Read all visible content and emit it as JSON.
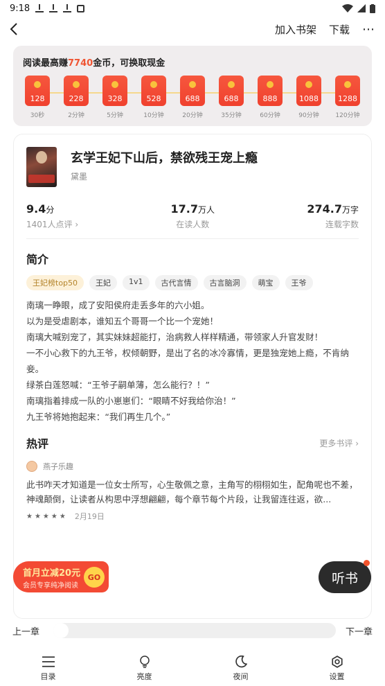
{
  "status_bar": {
    "time": "9:18"
  },
  "top_bar": {
    "add_shelf": "加入书架",
    "download": "下载",
    "more": "⋯"
  },
  "reward": {
    "title_prefix": "阅读最高赚",
    "coin_amount": "7740",
    "title_suffix": "金币，可换取现金",
    "steps": [
      {
        "value": "128",
        "time": "30秒"
      },
      {
        "value": "228",
        "time": "2分钟"
      },
      {
        "value": "328",
        "time": "5分钟"
      },
      {
        "value": "528",
        "time": "10分钟"
      },
      {
        "value": "688",
        "time": "20分钟"
      },
      {
        "value": "688",
        "time": "35分钟"
      },
      {
        "value": "888",
        "time": "60分钟"
      },
      {
        "value": "1088",
        "time": "90分钟"
      },
      {
        "value": "1288",
        "time": "120分钟"
      }
    ]
  },
  "book": {
    "title": "玄学王妃下山后，禁欲残王宠上瘾",
    "author": "黛墨",
    "score": "9.4",
    "score_unit": "分",
    "score_label": "1401人点评 ›",
    "readers": "17.7",
    "readers_unit": "万人",
    "readers_label": "在读人数",
    "words": "274.7",
    "words_unit": "万字",
    "words_label": "连载字数"
  },
  "intro": {
    "title": "简介",
    "tags": [
      "王妃榜top50",
      "王妃",
      "1v1",
      "古代言情",
      "古言脑洞",
      "萌宝",
      "王爷"
    ],
    "lines": [
      "南璃一睁眼，成了安阳侯府走丢多年的六小姐。",
      "以为是受虐剧本，谁知五个哥哥一个比一个宠她！",
      "南璃大喊别宠了，其实妹妹超能打，治病救人样样精通，带领家人升官发财！",
      "一不小心救下的九王爷，权倾朝野，是出了名的冰冷寡情，更是独宠她上瘾，不肯纳妾。",
      "绿茶白莲怒喊：“王爷子嗣单薄，怎么能行？！”",
      "南璃指着排成一队的小崽崽们：“眼睛不好我给你治！”",
      "九王爷将她抱起来：“我们再生几个。”"
    ]
  },
  "reviews": {
    "title": "热评",
    "more": "更多书评 ›",
    "user": "燕子乐趣",
    "text": "此书咋天才知道是一位女士所写，心生敬佩之意，主角写的栩栩如生，配角呢也不差，神魂颠倒，让读者从构思中浮想翩翩，每个章节每个片段，让我留连往返，欲...",
    "stars": "★★★★★",
    "date": "2月19日"
  },
  "promo": {
    "main": "首月立减20元",
    "sub": "会员专享纯净阅读",
    "go": "GO"
  },
  "listen": {
    "label": "听书"
  },
  "chapter_nav": {
    "prev": "上一章",
    "next": "下一章",
    "progress": 0
  },
  "toolbar": {
    "catalog": "目录",
    "brightness": "亮度",
    "night": "夜间",
    "settings": "设置"
  }
}
